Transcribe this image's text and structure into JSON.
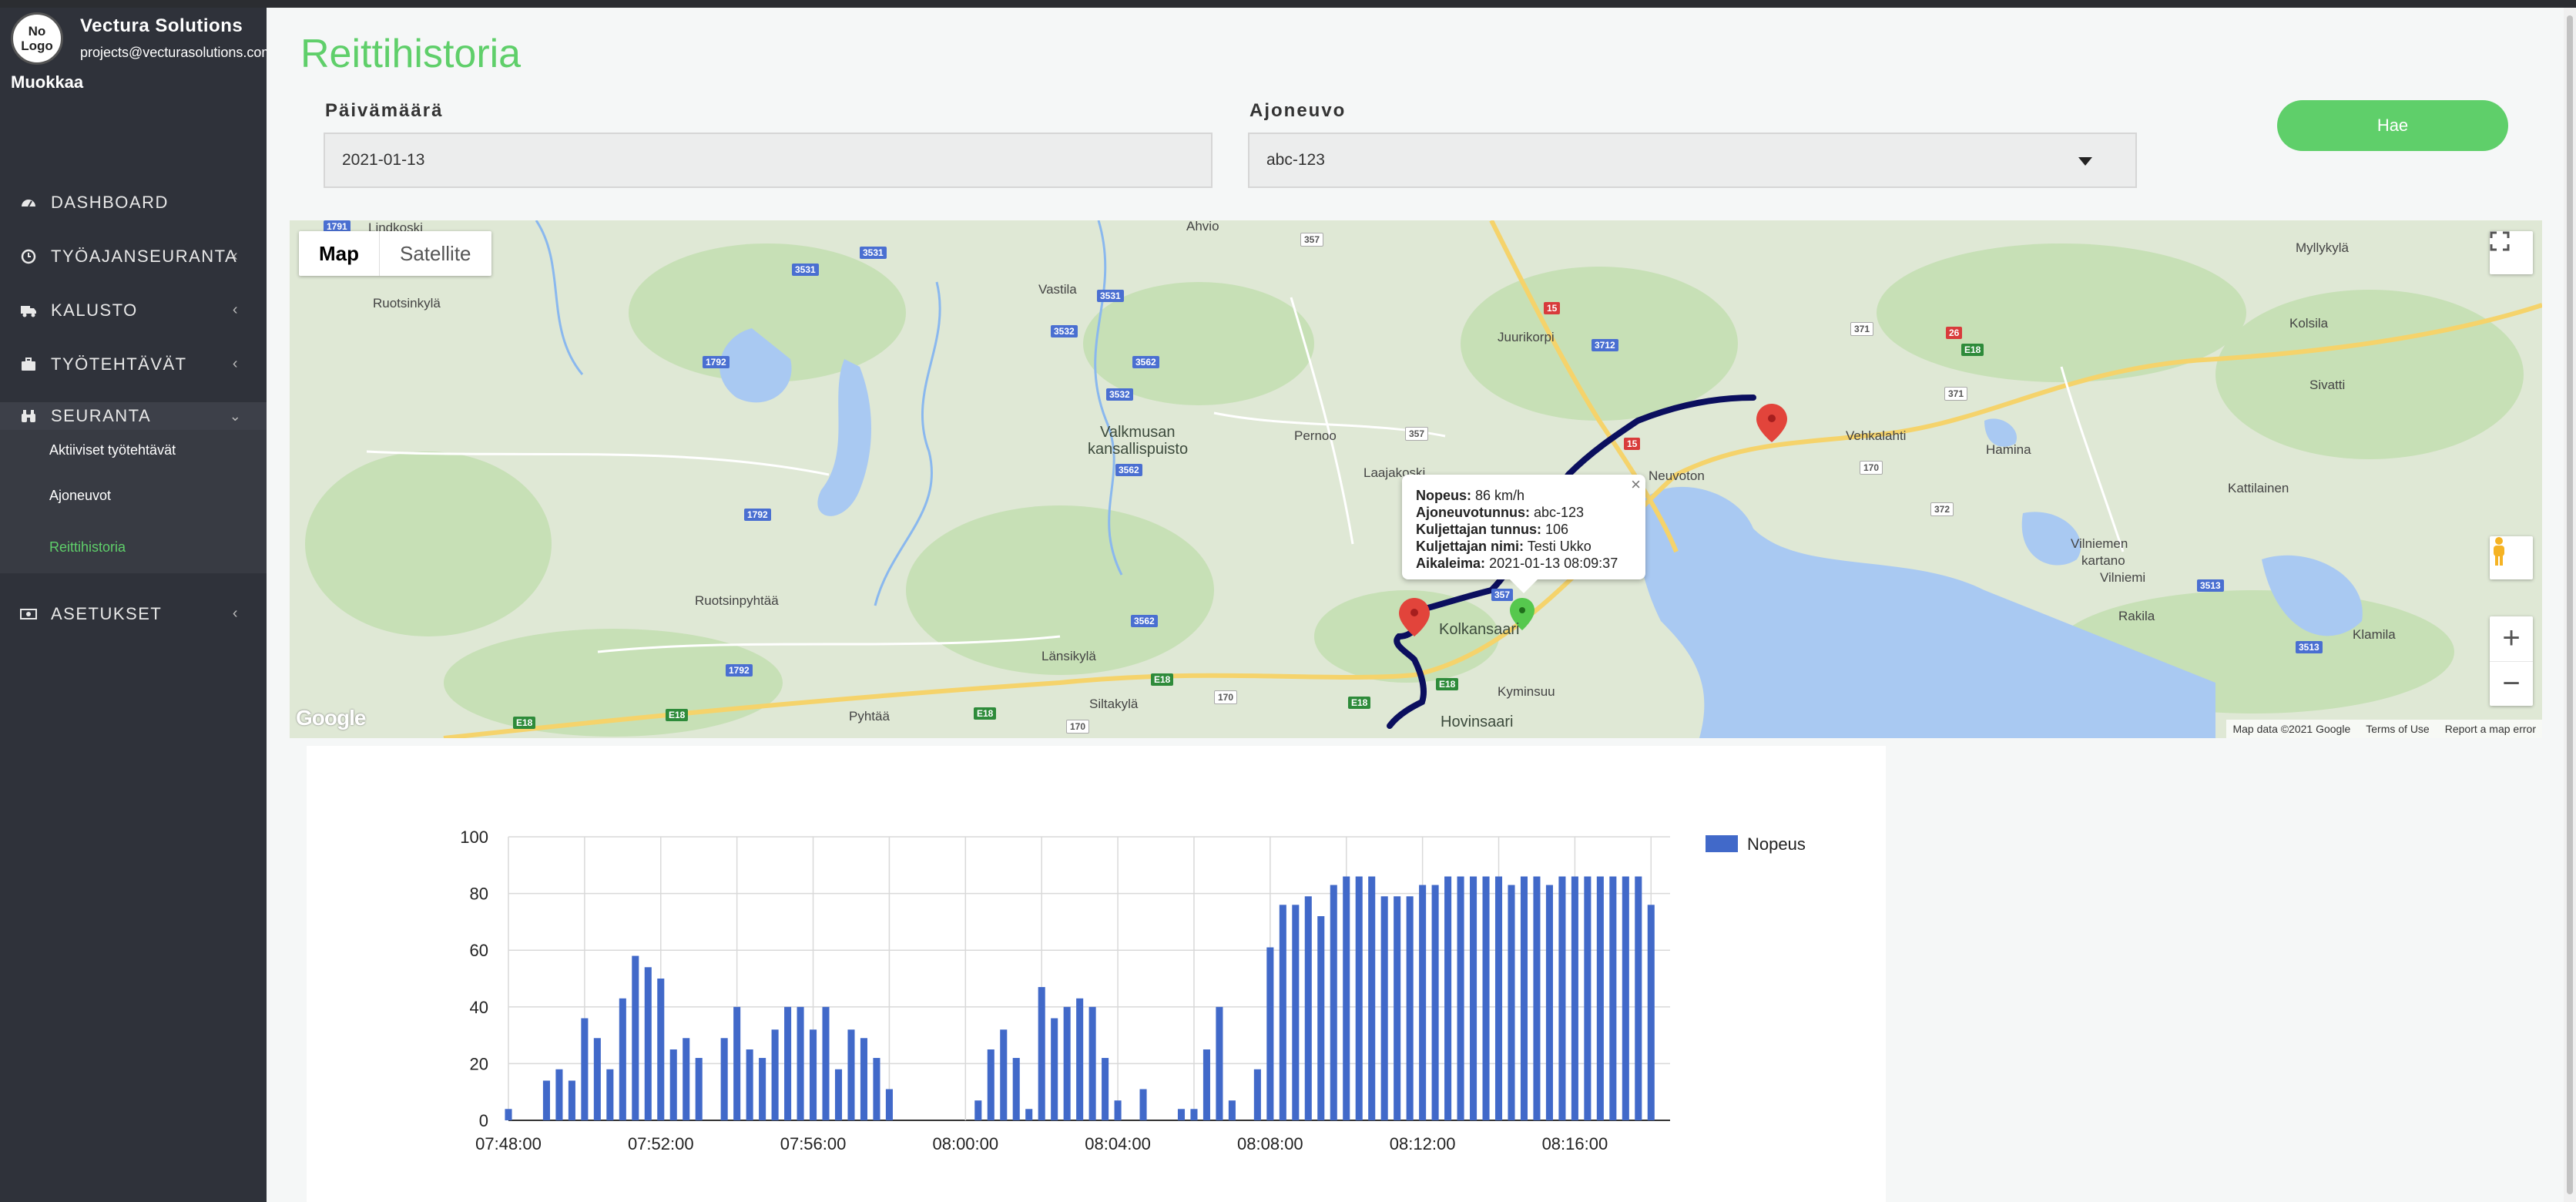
{
  "sidebar": {
    "logo_text": "No\nLogo",
    "company_name": "Vectura Solutions",
    "company_email": "projects@vecturasolutions.com",
    "edit_label": "Muokkaa",
    "items": [
      {
        "label": "DASHBOARD",
        "icon": "dashboard-icon"
      },
      {
        "label": "TYÖAJANSEURANTA",
        "icon": "clock-icon"
      },
      {
        "label": "KALUSTO",
        "icon": "truck-icon"
      },
      {
        "label": "TYÖTEHTÄVÄT",
        "icon": "briefcase-icon"
      },
      {
        "label": "SEURANTA",
        "icon": "binoculars-icon"
      },
      {
        "label": "ASETUKSET",
        "icon": "money-icon"
      }
    ],
    "subitems": [
      "Aktiiviset työtehtävät",
      "Ajoneuvot",
      "Reittihistoria"
    ]
  },
  "page": {
    "title": "Reittihistoria",
    "date_label": "Päivämäärä",
    "date_value": "2021-01-13",
    "vehicle_label": "Ajoneuvo",
    "vehicle_value": "abc-123",
    "search_button": "Hae"
  },
  "map": {
    "type_map": "Map",
    "type_satellite": "Satellite",
    "zoom_in": "+",
    "zoom_out": "−",
    "google": "Google",
    "footer_data": "Map data ©2021 Google",
    "footer_terms": "Terms of Use",
    "footer_report": "Report a map error",
    "places": {
      "lindkoski": "Lindkoski",
      "ahvio": "Ahvio",
      "myllykyla": "Myllykylä",
      "ruotsinkyla": "Ruotsinkylä",
      "vastila": "Vastila",
      "juurikorpi": "Juurikorpi",
      "kolsila": "Kolsila",
      "sivatti": "Sivatti",
      "valkmusan": "Valkmusan",
      "kansallispuisto": "kansallispuisto",
      "pernoo": "Pernoo",
      "laajakoski": "Laajakoski",
      "vehkalahti": "Vehkalahti",
      "hamina": "Hamina",
      "neuvoton": "Neuvoton",
      "kattilainen": "Kattilainen",
      "vilniemen": "Vilniemen",
      "kartano": "kartano",
      "vilniemi": "Vilniemi",
      "ruotsinpyhtaa": "Ruotsinpyhtää",
      "kolkansaari": "Kolkansaari",
      "rakila": "Rakila",
      "klamila": "Klamila",
      "lansikyla": "Länsikylä",
      "kyminsuu": "Kyminsuu",
      "pyhtaa": "Pyhtää",
      "siltakyla": "Siltakylä",
      "hovinsaari": "Hovinsaari"
    },
    "shields": [
      "1791",
      "3531",
      "3531",
      "357",
      "3531",
      "3532",
      "3562",
      "3532",
      "1792",
      "3562",
      "15",
      "3712",
      "371",
      "26",
      "E18",
      "371",
      "357",
      "15",
      "170",
      "372",
      "1792",
      "357",
      "3562",
      "1792",
      "3513",
      "E18",
      "170",
      "E18",
      "E18",
      "E18",
      "170",
      "E18",
      "E18",
      "3513"
    ],
    "info": {
      "speed_label": "Nopeus:",
      "speed_value": "86 km/h",
      "vehicle_label": "Ajoneuvotunnus:",
      "vehicle_value": "abc-123",
      "driver_id_label": "Kuljettajan tunnus:",
      "driver_id_value": "106",
      "driver_name_label": "Kuljettajan nimi:",
      "driver_name_value": "Testi Ukko",
      "timestamp_label": "Aikaleima:",
      "timestamp_value": "2021-01-13 08:09:37",
      "close": "×"
    },
    "colors": {
      "route": "#0b0f5e",
      "water": "#a9c9f2",
      "land": "#dfe8d5",
      "forest": "#c4dfb2",
      "road": "#f3d68a",
      "marker_red": "#e2443b",
      "marker_green": "#56c84e"
    }
  },
  "chart_data": {
    "type": "bar",
    "legend": "Nopeus",
    "legend_position": "right",
    "color": "#4169c9",
    "ylim": [
      0,
      100
    ],
    "yticks": [
      0,
      20,
      40,
      60,
      80,
      100
    ],
    "xlim_minutes": [
      0,
      30.5
    ],
    "xtick_labels": [
      "07:48:00",
      "07:52:00",
      "07:56:00",
      "08:00:00",
      "08:04:00",
      "08:08:00",
      "08:12:00",
      "08:16:00"
    ],
    "xtick_minutes": [
      0,
      4,
      8,
      12,
      16,
      20,
      24,
      28
    ],
    "values": [
      4,
      0,
      0,
      14,
      18,
      14,
      36,
      29,
      18,
      43,
      58,
      54,
      50,
      25,
      29,
      22,
      0,
      29,
      40,
      25,
      22,
      32,
      40,
      40,
      32,
      40,
      18,
      32,
      29,
      22,
      11,
      0,
      0,
      0,
      0,
      0,
      0,
      7,
      25,
      32,
      22,
      4,
      47,
      36,
      40,
      43,
      40,
      22,
      7,
      0,
      11,
      0,
      0,
      4,
      4,
      25,
      40,
      7,
      0,
      18,
      61,
      76,
      76,
      79,
      72,
      83,
      86,
      86,
      86,
      79,
      79,
      79,
      83,
      83,
      86,
      86,
      86,
      86,
      86,
      83,
      86,
      86,
      83,
      86,
      86,
      86,
      86,
      86,
      86,
      86,
      76
    ]
  }
}
